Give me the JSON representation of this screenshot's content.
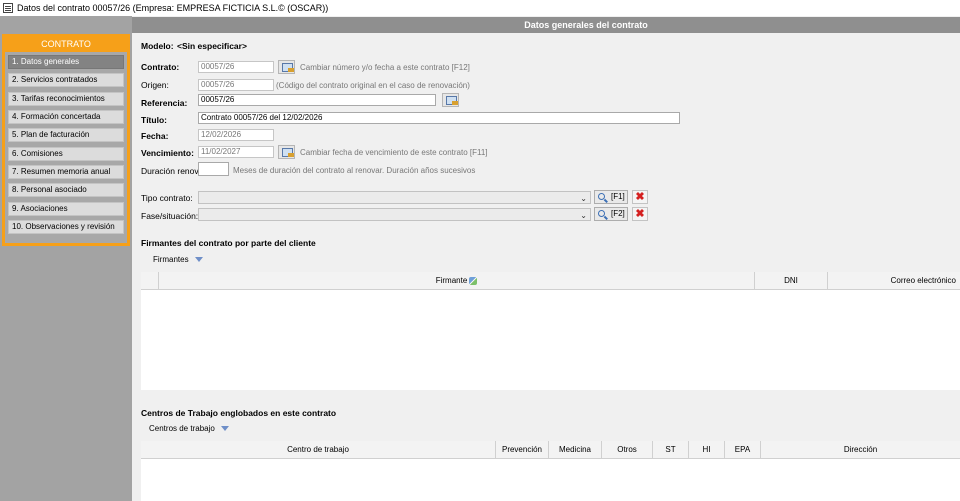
{
  "window": {
    "title": "Datos del contrato 00057/26  (Empresa: EMPRESA FICTICIA S.L.© (OSCAR))"
  },
  "sidebar": {
    "header": "CONTRATO",
    "items": [
      {
        "label": "1. Datos generales",
        "active": true
      },
      {
        "label": "2. Servicios contratados"
      },
      {
        "label": "3. Tarifas reconocimientos"
      },
      {
        "label": "4. Formación concertada"
      },
      {
        "label": "5. Plan de facturación"
      },
      {
        "label": "6. Comisiones"
      },
      {
        "label": "7. Resumen memoria anual"
      },
      {
        "label": "8. Personal asociado"
      },
      {
        "label": "9. Asociaciones"
      },
      {
        "label": "10. Observaciones y revisión"
      }
    ]
  },
  "main": {
    "header": "Datos generales del contrato",
    "modelo": {
      "label": "Modelo:",
      "value": "<Sin especificar>"
    },
    "contrato": {
      "label": "Contrato:",
      "value": "00057/26",
      "hint": "Cambiar número y/o fecha a este contrato  [F12]"
    },
    "origen": {
      "label": "Origen:",
      "value": "00057/26",
      "hint": "(Código del contrato original en el caso de renovación)"
    },
    "referencia": {
      "label": "Referencia:",
      "value": "00057/26"
    },
    "titulo": {
      "label": "Título:",
      "value": "Contrato 00057/26 del 12/02/2026"
    },
    "fecha": {
      "label": "Fecha:",
      "value": "12/02/2026"
    },
    "vencimiento": {
      "label": "Vencimiento:",
      "value": "11/02/2027",
      "hint": "Cambiar fecha de vencimiento de este contrato  [F11]"
    },
    "duracion": {
      "label": "Duración renov.",
      "value": "",
      "hint": "Meses de duración del contrato al renovar. Duración años sucesivos"
    },
    "tipo_contrato": {
      "label": "Tipo contrato:",
      "value": "",
      "key": "[F1]"
    },
    "fase": {
      "label": "Fase/situación:",
      "value": "",
      "key": "[F2]"
    },
    "firmantes": {
      "title": "Firmantes del contrato por parte del cliente",
      "dropdown": "Firmantes",
      "columns": [
        "Firmante",
        "DNI",
        "Correo electrónico"
      ],
      "rows": []
    },
    "centros": {
      "title": "Centros de Trabajo englobados en este contrato",
      "dropdown": "Centros de trabajo",
      "columns": [
        "Centro de trabajo",
        "Prevención",
        "Medicina",
        "Otros",
        "ST",
        "HI",
        "EPA",
        "Dirección"
      ],
      "rows": []
    }
  },
  "colors": {
    "accent": "#f6a019",
    "header_bg": "#8f8f8f",
    "sidebar_bg": "#a3a3a3",
    "delete_red": "#d42020"
  }
}
